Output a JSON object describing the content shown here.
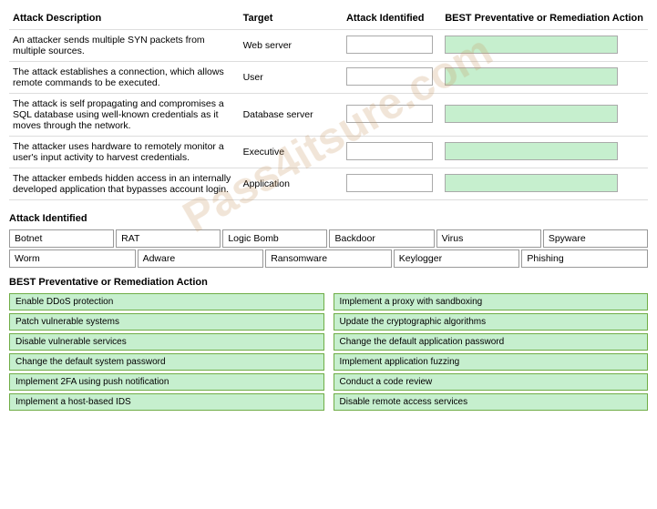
{
  "header": {
    "col_desc": "Attack Description",
    "col_target": "Target",
    "col_attack": "Attack Identified",
    "col_remedy": "BEST Preventative or Remediation Action"
  },
  "rows": [
    {
      "description": "An attacker sends multiple SYN packets from multiple sources.",
      "target": "Web server"
    },
    {
      "description": "The attack establishes a connection, which allows remote commands to be executed.",
      "target": "User"
    },
    {
      "description": "The attack is self propagating and compromises a SQL database using well-known credentials as it moves through the network.",
      "target": "Database server"
    },
    {
      "description": "The attacker uses hardware to remotely monitor a user's input activity to harvest credentials.",
      "target": "Executive"
    },
    {
      "description": "The attacker embeds hidden access in an internally developed application that bypasses account login.",
      "target": "Application"
    }
  ],
  "section_attack": "Attack Identified",
  "attack_row1": [
    "Botnet",
    "RAT",
    "Logic Bomb",
    "Backdoor",
    "Virus",
    "Spyware"
  ],
  "attack_row2": [
    "Worm",
    "Adware",
    "Ransomware",
    "Keylogger",
    "Phishing"
  ],
  "section_remedy": "BEST Preventative or Remediation Action",
  "remedy_left": [
    "Enable DDoS protection",
    "Patch vulnerable systems",
    "Disable vulnerable services",
    "Change the default system password",
    "Implement 2FA using push notification",
    "Implement a host-based IDS"
  ],
  "remedy_right": [
    "Implement a proxy with sandboxing",
    "Update the cryptographic algorithms",
    "Change the default application password",
    "Implement application fuzzing",
    "Conduct a code review",
    "Disable remote access services"
  ]
}
